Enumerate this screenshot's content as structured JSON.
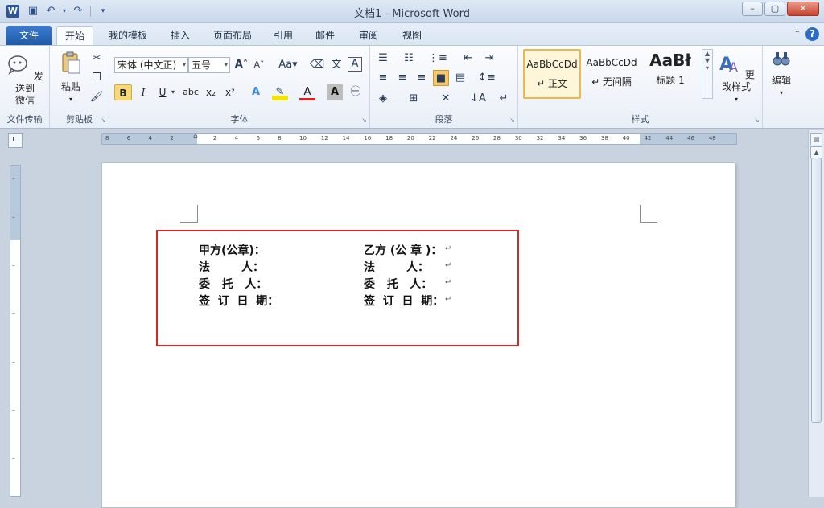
{
  "window": {
    "app_icon": "W",
    "title": "文档1 - Microsoft Word",
    "controls": [
      "–",
      "▢",
      "✕"
    ]
  },
  "quick_access": [
    "save-icon",
    "undo-icon",
    "redo-icon",
    "customize-icon"
  ],
  "tabs": {
    "file": "文件",
    "items": [
      "开始",
      "我的模板",
      "插入",
      "页面布局",
      "引用",
      "邮件",
      "审阅",
      "视图"
    ],
    "active": "开始"
  },
  "ribbon": {
    "send_group": {
      "button": "发送到\n微信",
      "label": "文件传输"
    },
    "clipboard": {
      "paste": "粘贴",
      "label": "剪贴板"
    },
    "font": {
      "name": "宋体 (中文正)",
      "size": "五号",
      "label": "字体",
      "bold": "B",
      "italic": "I",
      "underline": "U",
      "strike": "abc",
      "subscript": "x₂",
      "superscript": "x²"
    },
    "paragraph": {
      "label": "段落"
    },
    "styles": {
      "items": [
        {
          "sample": "AaBbCcDd",
          "name": "↵ 正文"
        },
        {
          "sample": "AaBbCcDd",
          "name": "↵ 无间隔"
        },
        {
          "sample": "AaBł",
          "name": "标题 1"
        }
      ],
      "change_styles": "更改样式",
      "label": "样式"
    },
    "editing": {
      "button": "编辑"
    }
  },
  "ruler": {
    "ticks": [
      "8",
      "6",
      "4",
      "2",
      "",
      "2",
      "4",
      "6",
      "8",
      "10",
      "12",
      "14",
      "16",
      "18",
      "20",
      "22",
      "24",
      "26",
      "28",
      "30",
      "32",
      "34",
      "36",
      "38",
      "40",
      "42",
      "44",
      "46",
      "48"
    ]
  },
  "document": {
    "rows": [
      {
        "left": "甲方(公章)：",
        "right": "乙方 (公 章 )："
      },
      {
        "left": "法        人：",
        "right": "法        人："
      },
      {
        "left": "委   托   人：",
        "right": "委   托   人："
      },
      {
        "left": "签  订  日  期：",
        "right": "签  订  日  期："
      }
    ],
    "para_mark": "↵",
    "highlight_color": "#d8262b"
  }
}
